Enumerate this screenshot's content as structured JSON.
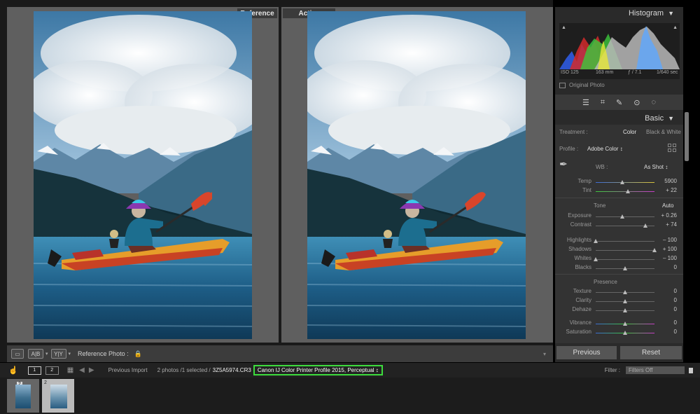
{
  "view": {
    "reference_label": "Reference",
    "active_label": "Active",
    "toolbar": {
      "view_mode_a": "A|B",
      "view_mode_b": "Y|Y",
      "reference_photo_label": "Reference Photo :"
    }
  },
  "histogram": {
    "title": "Histogram",
    "iso": "ISO 125",
    "focal": "163 mm",
    "aperture": "ƒ / 7.1",
    "shutter": "1/640 sec",
    "original_photo": "Original Photo"
  },
  "basic": {
    "title": "Basic",
    "treatment_label": "Treatment :",
    "treatment_color": "Color",
    "treatment_bw": "Black & White",
    "profile_label": "Profile :",
    "profile_value": "Adobe Color ↕",
    "wb_label": "WB :",
    "wb_value": "As Shot ↕",
    "temp_label": "Temp",
    "temp_value": "5900",
    "tint_label": "Tint",
    "tint_value": "+ 22",
    "tone_label": "Tone",
    "auto_label": "Auto",
    "exposure_label": "Exposure",
    "exposure_value": "+ 0.26",
    "contrast_label": "Contrast",
    "contrast_value": "+ 74",
    "highlights_label": "Highlights",
    "highlights_value": "– 100",
    "shadows_label": "Shadows",
    "shadows_value": "+ 100",
    "whites_label": "Whites",
    "whites_value": "– 100",
    "blacks_label": "Blacks",
    "blacks_value": "0",
    "presence_label": "Presence",
    "texture_label": "Texture",
    "texture_value": "0",
    "clarity_label": "Clarity",
    "clarity_value": "0",
    "dehaze_label": "Dehaze",
    "dehaze_value": "0",
    "vibrance_label": "Vibrance",
    "vibrance_value": "0",
    "saturation_label": "Saturation",
    "saturation_value": "0"
  },
  "buttons": {
    "previous": "Previous",
    "reset": "Reset"
  },
  "filmstrip": {
    "monitor1": "1",
    "monitor2": "2",
    "source": "Previous Import",
    "count": "2 photos /1 selected /",
    "filename": "3Z5A5974.CR3",
    "profile": "Canon IJ Color Printer Profile 2015, Perceptual ↕",
    "filter_label": "Filter :",
    "filter_value": "Filters Off",
    "thumb1_badge": "2",
    "thumb2_badge": "2"
  },
  "slider_levels": {
    "temp": 0.45,
    "tint": 0.55,
    "exposure": 0.45,
    "contrast": 0.85,
    "highlights": 0.0,
    "shadows": 1.0,
    "whites": 0.0,
    "blacks": 0.5,
    "texture": 0.5,
    "clarity": 0.5,
    "dehaze": 0.5,
    "vibrance": 0.5,
    "saturation": 0.5
  },
  "colors": {
    "accent_green": "#3ddc3d",
    "lock_yellow": "#d6a829"
  }
}
